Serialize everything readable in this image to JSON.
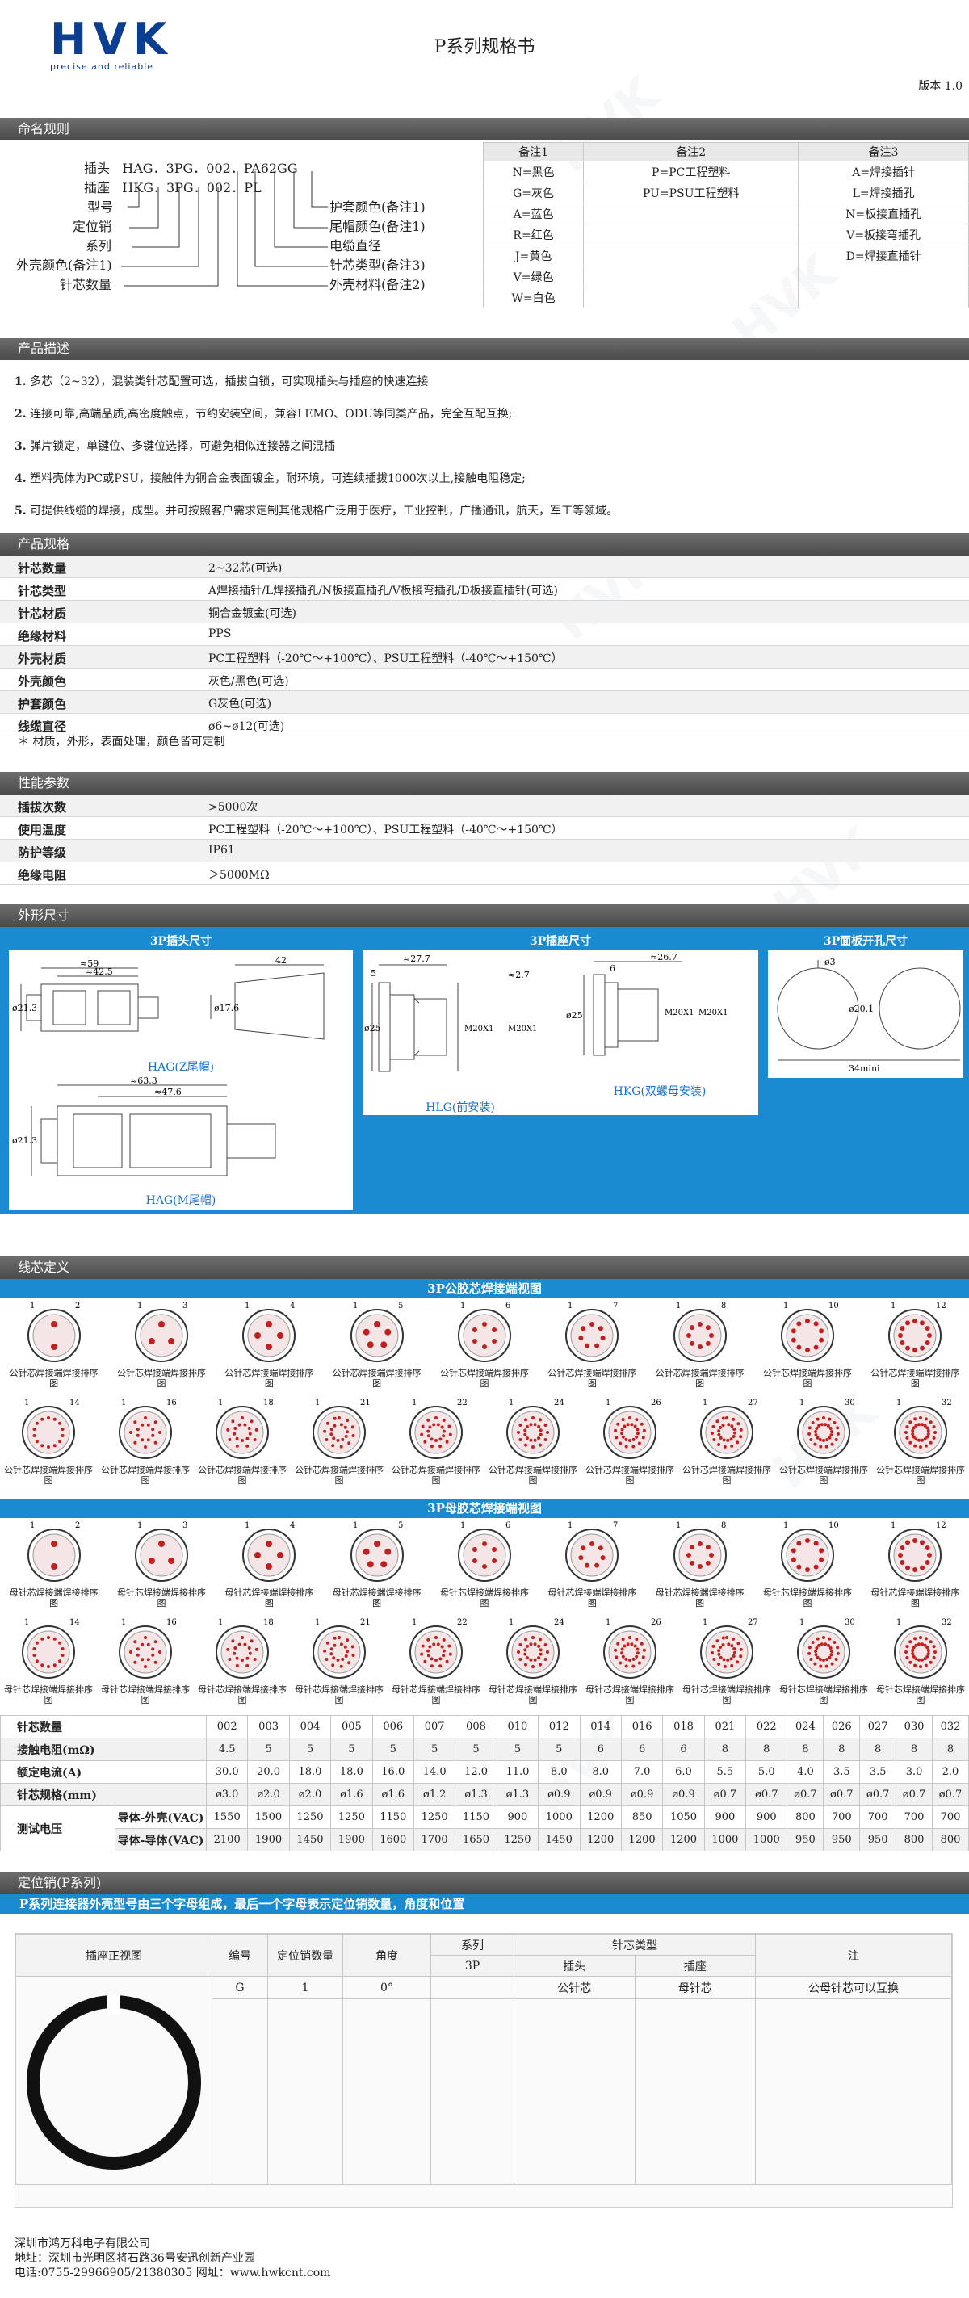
{
  "header": {
    "logo_text": "HVK",
    "logo_tagline": "precise and reliable",
    "title": "P系列规格书",
    "version": "版本 1.0"
  },
  "sections": {
    "naming": "命名规则",
    "description": "产品描述",
    "specs": "产品规格",
    "performance": "性能参数",
    "dimensions": "外形尺寸",
    "wiring": "线芯定义",
    "locating": "定位销(P系列)"
  },
  "naming": {
    "plug_label": "插头",
    "plug_code": "HAG．3PG．002．PA62GG",
    "socket_label": "插座",
    "socket_code": "HKG．3PG．002．PL",
    "left_labels": [
      "型号",
      "定位销",
      "系列",
      "外壳颜色(备注1)",
      "针芯数量"
    ],
    "right_labels": [
      "护套颜色(备注1)",
      "尾帽颜色(备注1)",
      "电缆直径",
      "针芯类型(备注3)",
      "外壳材料(备注2)"
    ],
    "notes_headers": [
      "备注1",
      "备注2",
      "备注3"
    ],
    "notes_rows": [
      [
        "N=黑色",
        "P=PC工程塑料",
        "A=焊接插针"
      ],
      [
        "G=灰色",
        "PU=PSU工程塑料",
        "L=焊接插孔"
      ],
      [
        "A=蓝色",
        "",
        "N=板接直插孔"
      ],
      [
        "R=红色",
        "",
        "V=板接弯插孔"
      ],
      [
        "J=黄色",
        "",
        "D=焊接直插针"
      ],
      [
        "V=绿色",
        "",
        ""
      ],
      [
        "W=白色",
        "",
        ""
      ]
    ]
  },
  "description": [
    {
      "num": "1.",
      "text": "多芯（2~32），混装类针芯配置可选，插拔自锁，可实现插头与插座的快速连接"
    },
    {
      "num": "2.",
      "text": "连接可靠,高端品质,高密度触点，节约安装空间，兼容LEMO、ODU等同类产品，完全互配互换;"
    },
    {
      "num": "3.",
      "text": "弹片锁定，单键位、多键位选择，可避免相似连接器之间混插"
    },
    {
      "num": "4.",
      "text": "塑料壳体为PC或PSU，接触件为铜合金表面镀金，耐环境，可连续插拔1000次以上,接触电阻稳定;"
    },
    {
      "num": "5.",
      "text": "可提供线缆的焊接，成型。并可按照客户需求定制其他规格广泛用于医疗，工业控制，广播通讯，航天，军工等领域。"
    }
  ],
  "specs": [
    {
      "label": "针芯数量",
      "value": "2~32芯(可选)"
    },
    {
      "label": "针芯类型",
      "value": "A焊接插针/L焊接插孔/N板接直插孔/V板接弯插孔/D板接直插针(可选)"
    },
    {
      "label": "针芯材质",
      "value": "铜合金镀金(可选)"
    },
    {
      "label": "绝缘材料",
      "value": "PPS"
    },
    {
      "label": "外壳材质",
      "value": "PC工程塑料（-20℃～+100℃）、PSU工程塑料（-40℃～+150℃）"
    },
    {
      "label": "外壳颜色",
      "value": "灰色/黑色(可选)"
    },
    {
      "label": "护套颜色",
      "value": "G灰色(可选)"
    },
    {
      "label": "线缆直径",
      "value": "ø6~ø12(可选)"
    }
  ],
  "specs_note": "＊ 材质，外形，表面处理，颜色皆可定制",
  "performance": [
    {
      "label": "插拔次数",
      "value": ">5000次"
    },
    {
      "label": "使用温度",
      "value": "PC工程塑料（-20℃～+100℃）、PSU工程塑料（-40℃～+150℃）"
    },
    {
      "label": "防护等级",
      "value": "IP61"
    },
    {
      "label": "绝缘电阻",
      "value": "＞5000MΩ"
    }
  ],
  "dimensions": {
    "plug_panel_title": "3P插头尺寸",
    "socket_panel_title": "3P插座尺寸",
    "cutout_panel_title": "3P面板开孔尺寸",
    "hag_z": {
      "caption": "HAG(Z尾帽)",
      "d1": "≈59",
      "d2": "≈42.5",
      "d3": "42",
      "d4": "ø21.3",
      "d5": "ø17.6"
    },
    "hag_m": {
      "caption": "HAG(M尾帽)",
      "d1": "≈63.3",
      "d2": "≈47.6",
      "d3": "ø21.3"
    },
    "hlg": {
      "caption": "HLG(前安装)",
      "d1": "≈27.7",
      "d2": "5",
      "d3": "≈2.7",
      "d4": "ø25",
      "d5": "M20X1",
      "d6": "M20X1"
    },
    "hkg": {
      "caption": "HKG(双螺母安装)",
      "d1": "≈26.7",
      "d2": "6",
      "d3": "ø25",
      "d4": "M20X1",
      "d5": "M20X1"
    },
    "cutout": {
      "d1": "ø3",
      "d2": "ø20.1",
      "d3": "34mini"
    }
  },
  "wiring": {
    "male_title": "3P公胶芯焊接端视图",
    "female_title": "3P母胶芯焊接端视图",
    "male_caption": "公针芯焊接端焊接排序图",
    "female_caption": "母针芯焊接端焊接排序图",
    "male_counts": [
      "2",
      "3",
      "4",
      "5",
      "6",
      "7",
      "8",
      "10",
      "12",
      "14",
      "16",
      "18",
      "21",
      "22",
      "24",
      "26",
      "27",
      "30",
      "32"
    ],
    "female_counts": [
      "2",
      "3",
      "4",
      "5",
      "6",
      "7",
      "8",
      "10",
      "12",
      "14",
      "16",
      "18",
      "21",
      "22",
      "24",
      "26",
      "27",
      "30",
      "32"
    ],
    "table": {
      "row_labels": [
        "针芯数量",
        "接触电阻(mΩ)",
        "额定电流(A)",
        "针芯规格(mm)"
      ],
      "voltage_label": "测试电压",
      "voltage_sub": [
        "导体-外壳(VAC)",
        "导体-导体(VAC)"
      ],
      "counts": [
        "002",
        "003",
        "004",
        "005",
        "006",
        "007",
        "008",
        "010",
        "012",
        "014",
        "016",
        "018",
        "021",
        "022",
        "024",
        "026",
        "027",
        "030",
        "032"
      ],
      "resistance": [
        "4.5",
        "5",
        "5",
        "5",
        "5",
        "5",
        "5",
        "5",
        "5",
        "6",
        "6",
        "6",
        "8",
        "8",
        "8",
        "8",
        "8",
        "8",
        "8"
      ],
      "current": [
        "30.0",
        "20.0",
        "18.0",
        "18.0",
        "16.0",
        "14.0",
        "12.0",
        "11.0",
        "8.0",
        "8.0",
        "7.0",
        "6.0",
        "5.5",
        "5.0",
        "4.0",
        "3.5",
        "3.5",
        "3.0",
        "2.0"
      ],
      "pin_size": [
        "ø3.0",
        "ø2.0",
        "ø2.0",
        "ø1.6",
        "ø1.6",
        "ø1.2",
        "ø1.3",
        "ø1.3",
        "ø0.9",
        "ø0.9",
        "ø0.9",
        "ø0.9",
        "ø0.7",
        "ø0.7",
        "ø0.7",
        "ø0.7",
        "ø0.7",
        "ø0.7",
        "ø0.7"
      ],
      "v_shell": [
        "1550",
        "1500",
        "1250",
        "1250",
        "1150",
        "1250",
        "1150",
        "900",
        "1000",
        "1200",
        "850",
        "1050",
        "900",
        "900",
        "800",
        "700",
        "700",
        "700",
        "700"
      ],
      "v_conductor": [
        "2100",
        "1900",
        "1450",
        "1900",
        "1600",
        "1700",
        "1650",
        "1250",
        "1450",
        "1200",
        "1200",
        "1200",
        "1000",
        "1000",
        "950",
        "950",
        "950",
        "800",
        "800"
      ]
    }
  },
  "locating": {
    "subtitle": "P系列连接器外壳型号由三个字母组成，最后一个字母表示定位销数量，角度和位置",
    "headers": {
      "view": "插座正视图",
      "code": "编号",
      "count": "定位销数量",
      "angle": "角度",
      "series": "系列",
      "series_sub": "3P",
      "pintype": "针芯类型",
      "plug": "插头",
      "socket": "插座",
      "note": "注"
    },
    "row": {
      "code": "G",
      "count": "1",
      "angle": "0°",
      "plug": "公针芯",
      "socket": "母针芯",
      "note": "公母针芯可以互换"
    }
  },
  "footer": {
    "company": "深圳市鸿万科电子有限公司",
    "address": "地址：深圳市光明区将石路36号安迅创新产业园",
    "contact": "电话:0755-29966905/21380305  网址：www.hwkcnt.com"
  }
}
